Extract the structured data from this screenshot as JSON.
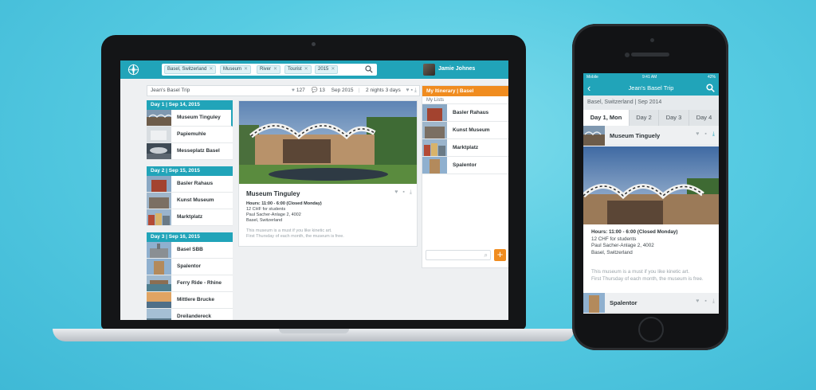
{
  "desktop": {
    "search_tags": [
      "Basel, Switzerland",
      "Museum",
      "River",
      "Tourist",
      "2015"
    ],
    "user": {
      "name": "Jamie Johnes"
    },
    "trip": {
      "title": "Jean's Basel Trip",
      "likes": "127",
      "comments": "13",
      "date": "Sep 2015",
      "duration": "2 nights 3 days"
    },
    "days": [
      {
        "header": "Day 1 | Sep 14, 2015",
        "places": [
          "Museum Tinguley",
          "Papiemuhle",
          "Messeplatz Basel"
        ]
      },
      {
        "header": "Day 2 | Sep 15, 2015",
        "places": [
          "Basler Rahaus",
          "Kunst Museum",
          "Marktplatz"
        ]
      },
      {
        "header": "Day 3 | Sep 16, 2015",
        "places": [
          "Basel SBB",
          "Spalentor",
          "Ferry Ride - Rhine",
          "Mittlere Brucke",
          "Dreilandereck"
        ]
      }
    ],
    "detail": {
      "title": "Museum Tinguley",
      "hours": "Hours: 11:00 - 6:00 (Closed Monday)",
      "price": "12 CHF for students",
      "address1": "Paul Sacher-Anlage 2, 4002",
      "address2": "Basel, Switzerland",
      "desc1": "This museum is a must if you like kinetic art.",
      "desc2": "First Thursday of each month, the museum is free."
    },
    "itinerary": {
      "header": "My Itinerary | Basel",
      "sublabel": "My Lists",
      "items": [
        "Basler Rahaus",
        "Kunst Museum",
        "Marktplatz",
        "Spalentor"
      ],
      "add_label": "+"
    }
  },
  "mobile": {
    "status": {
      "carrier": "Mobile",
      "time": "9:41 AM",
      "battery": "42%"
    },
    "title": "Jean's Basel Trip",
    "location": "Basel, Switzerland | Sep 2014",
    "tabs": [
      "Day 1, Mon",
      "Day 2",
      "Day 3",
      "Day 4"
    ],
    "current_place": "Museum Tinguely",
    "next_place": "Spalentor",
    "hours": "Hours: 11:00 - 6:00 (Closed Monday)",
    "price": "12 CHF for students",
    "address1": "Paul Sacher-Anlage 2, 4002",
    "address2": "Basel, Switzerland",
    "desc1": "This museum is a must if you like kinetic art.",
    "desc2": "First Thursday of each month, the museum is free."
  },
  "colors": {
    "accent": "#21a4b9",
    "orange": "#f08c1f",
    "background": "#56cbe2"
  }
}
